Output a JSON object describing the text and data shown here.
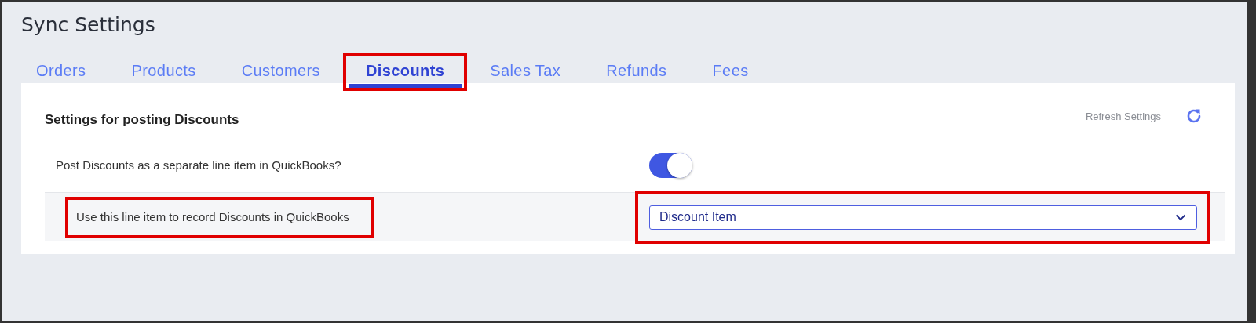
{
  "page": {
    "title": "Sync Settings"
  },
  "tabs": [
    {
      "label": "Orders",
      "selected": false,
      "highlighted": false
    },
    {
      "label": "Products",
      "selected": false,
      "highlighted": false
    },
    {
      "label": "Customers",
      "selected": false,
      "highlighted": false
    },
    {
      "label": "Discounts",
      "selected": true,
      "highlighted": true
    },
    {
      "label": "Sales Tax",
      "selected": false,
      "highlighted": false
    },
    {
      "label": "Refunds",
      "selected": false,
      "highlighted": false
    },
    {
      "label": "Fees",
      "selected": false,
      "highlighted": false
    }
  ],
  "panel": {
    "heading": "Settings for posting Discounts",
    "refresh": {
      "label": "Refresh Settings"
    },
    "settings": [
      {
        "kind": "toggle",
        "label": "Post Discounts as a separate line item in QuickBooks?",
        "on": true,
        "label_highlighted": false
      },
      {
        "kind": "select",
        "label": "Use this line item to record Discounts in QuickBooks",
        "value": "Discount Item",
        "label_highlighted": true,
        "value_highlighted": true
      }
    ]
  }
}
